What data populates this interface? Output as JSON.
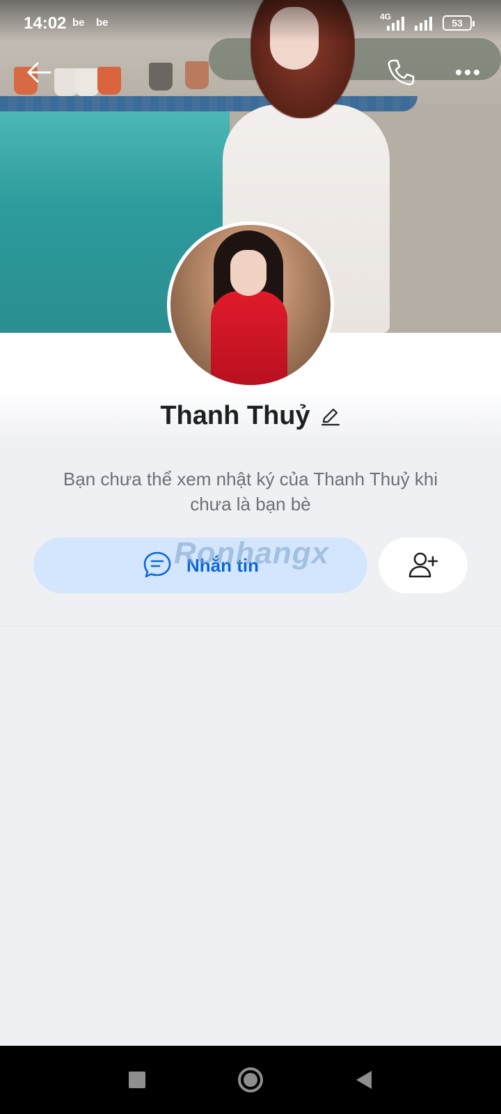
{
  "status_bar": {
    "time": "14:02",
    "notification_icons": [
      "be",
      "be"
    ],
    "network": "4G",
    "battery": "53"
  },
  "header": {
    "back_icon": "arrow-left-icon",
    "call_icon": "phone-icon",
    "more_icon": "more-horizontal-icon"
  },
  "profile": {
    "name": "Thanh Thuỷ",
    "edit_icon": "pencil-icon",
    "notice": "Bạn chưa thể xem nhật ký của Thanh Thuỷ khi chưa là bạn bè"
  },
  "actions": {
    "message_label": "Nhắn tin",
    "message_icon": "chat-bubble-icon",
    "add_friend_icon": "add-user-icon"
  },
  "watermark": "Ronhangx",
  "nav_bar": {
    "recents_icon": "square-icon",
    "home_icon": "circle-icon",
    "back_icon": "triangle-back-icon"
  },
  "colors": {
    "accent": "#0a67d8",
    "message_button_bg": "#d4e6fd",
    "background": "#eff0f4"
  }
}
